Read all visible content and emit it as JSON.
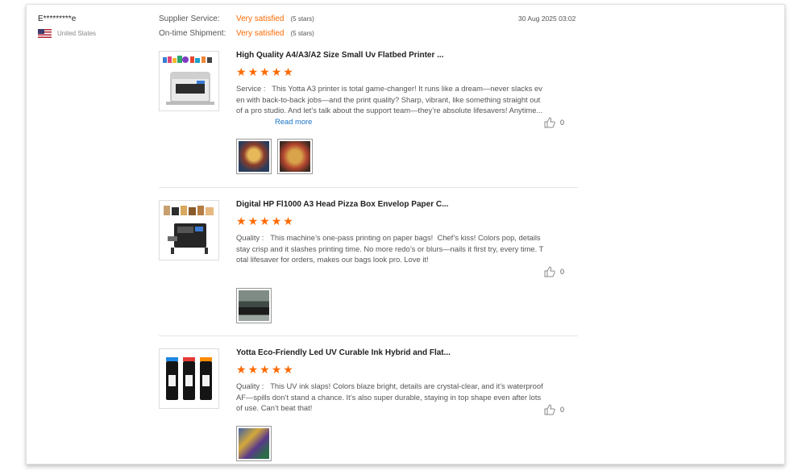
{
  "reviewer": {
    "name": "E*********e",
    "country": "United States",
    "flag_icon": "us-flag-icon"
  },
  "ratings": [
    {
      "label": "Supplier Service:",
      "value": "Very satisfied",
      "stars": "(5 stars)"
    },
    {
      "label": "On-time Shipment:",
      "value": "Very satisfied",
      "stars": "(5 stars)"
    }
  ],
  "date": "30 Aug 2025 03:02",
  "reviews": [
    {
      "title": "High Quality A4/A3/A2 Size Small Uv Flatbed Printer ...",
      "rating": 5,
      "text": "Service :   This Yotta A3 printer is total game-changer! It runs like a dream—never slacks even with back-to-back jobs—and the print quality? Sharp, vibrant, like something straight out of a pro studio. And let’s talk about the support team—they’re absolute lifesavers! Anytime...",
      "read_more": "Read more",
      "likes": "0",
      "photo_count": 2
    },
    {
      "title": "Digital HP Fl1000 A3 Head Pizza Box Envelop Paper C...",
      "rating": 5,
      "text": "Quality :   This machine’s one-pass printing on paper bags!  Chef’s kiss! Colors pop, details stay crisp and it slashes printing time. No more redo’s or blurs—nails it first try, every time. Total lifesaver for orders, makes our bags look pro. Love it!",
      "likes": "0",
      "photo_count": 1
    },
    {
      "title": "Yotta Eco-Friendly Led UV Curable Ink Hybrid and Flat...",
      "rating": 5,
      "text": "Quality :   This UV ink slaps! Colors blaze bright, details are crystal-clear, and it’s waterproof AF—spills don’t stand a chance. It’s also super durable, staying in top shape even after lots of use. Can’t beat that!",
      "likes": "0",
      "photo_count": 1
    }
  ],
  "colors": {
    "accent": "#ff6a00",
    "link": "#1a73c8"
  }
}
